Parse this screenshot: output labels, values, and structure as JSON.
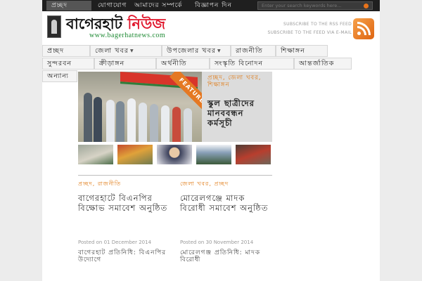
{
  "topbar": {
    "nav": [
      {
        "label": "প্রচ্ছদ"
      },
      {
        "label": "যোগাযোগ"
      },
      {
        "label": "আমাদের সম্পর্কে"
      },
      {
        "label": "বিজ্ঞাপন দিন"
      }
    ],
    "search_placeholder": "Enter your search keywords here..."
  },
  "header": {
    "logo_part1": "বাগেরহাট",
    "logo_part2": "নিউজ",
    "logo_url": "www.bagerhatnews.com",
    "subscribe_rss": "SUBSCRIBE TO THE RSS FEED",
    "subscribe_email": "SUBSCRIBE TO THE FEED VIA E-MAIL"
  },
  "main_nav": {
    "row1": [
      {
        "label": "প্রচ্ছদ"
      },
      {
        "label": "জেলা খবর",
        "has_dropdown": true
      },
      {
        "label": "উপজেলার খবর",
        "has_dropdown": true
      },
      {
        "label": "রাজনীতি"
      },
      {
        "label": "শিক্ষাঙ্গন"
      }
    ],
    "row2": [
      {
        "label": "সুন্দরবন"
      },
      {
        "label": "ক্রীড়াঙ্গন"
      },
      {
        "label": "অর্থনীতি"
      },
      {
        "label": "সংস্কৃতি বিনোদন"
      },
      {
        "label": "আন্তর্জাতিক"
      }
    ],
    "row3": [
      {
        "label": "অন্যান্য"
      }
    ]
  },
  "featured": {
    "ribbon": "FEATURED",
    "categories": "প্রচ্ছদ, জেলা খবর, শিক্ষাঙ্গন",
    "title": "স্কুল ছাত্রীদের মানববন্ধন কর্মসূচী"
  },
  "posts": [
    {
      "category": "প্রচ্ছদ, রাজনীতি",
      "title": "বাগেরহাটে বিএনপির বিক্ষোভ সমাবেশ অনুষ্ঠিত",
      "date": "Posted on 01 December 2014",
      "excerpt": "বাগেরহাট প্রতিনিধি: বিএনপির উদ্যোগে"
    },
    {
      "category": "জেলা খবর, প্রচ্ছদ",
      "title": "মোরেলগঞ্জে মাদক বিরোধী সমাবেশ অনুষ্ঠিত",
      "date": "Posted on 30 November 2014",
      "excerpt": "মোরেলগঞ্জ প্রতিনিধি: মাদক বিরোধী"
    }
  ],
  "colors": {
    "accent_orange": "#e07a14",
    "logo_red": "#e0182d",
    "url_green": "#1e8a34",
    "topbar_bg": "#1f1f1f"
  },
  "icons": [
    "search-icon",
    "rss-icon",
    "logo-icon",
    "chevron-down-icon"
  ]
}
